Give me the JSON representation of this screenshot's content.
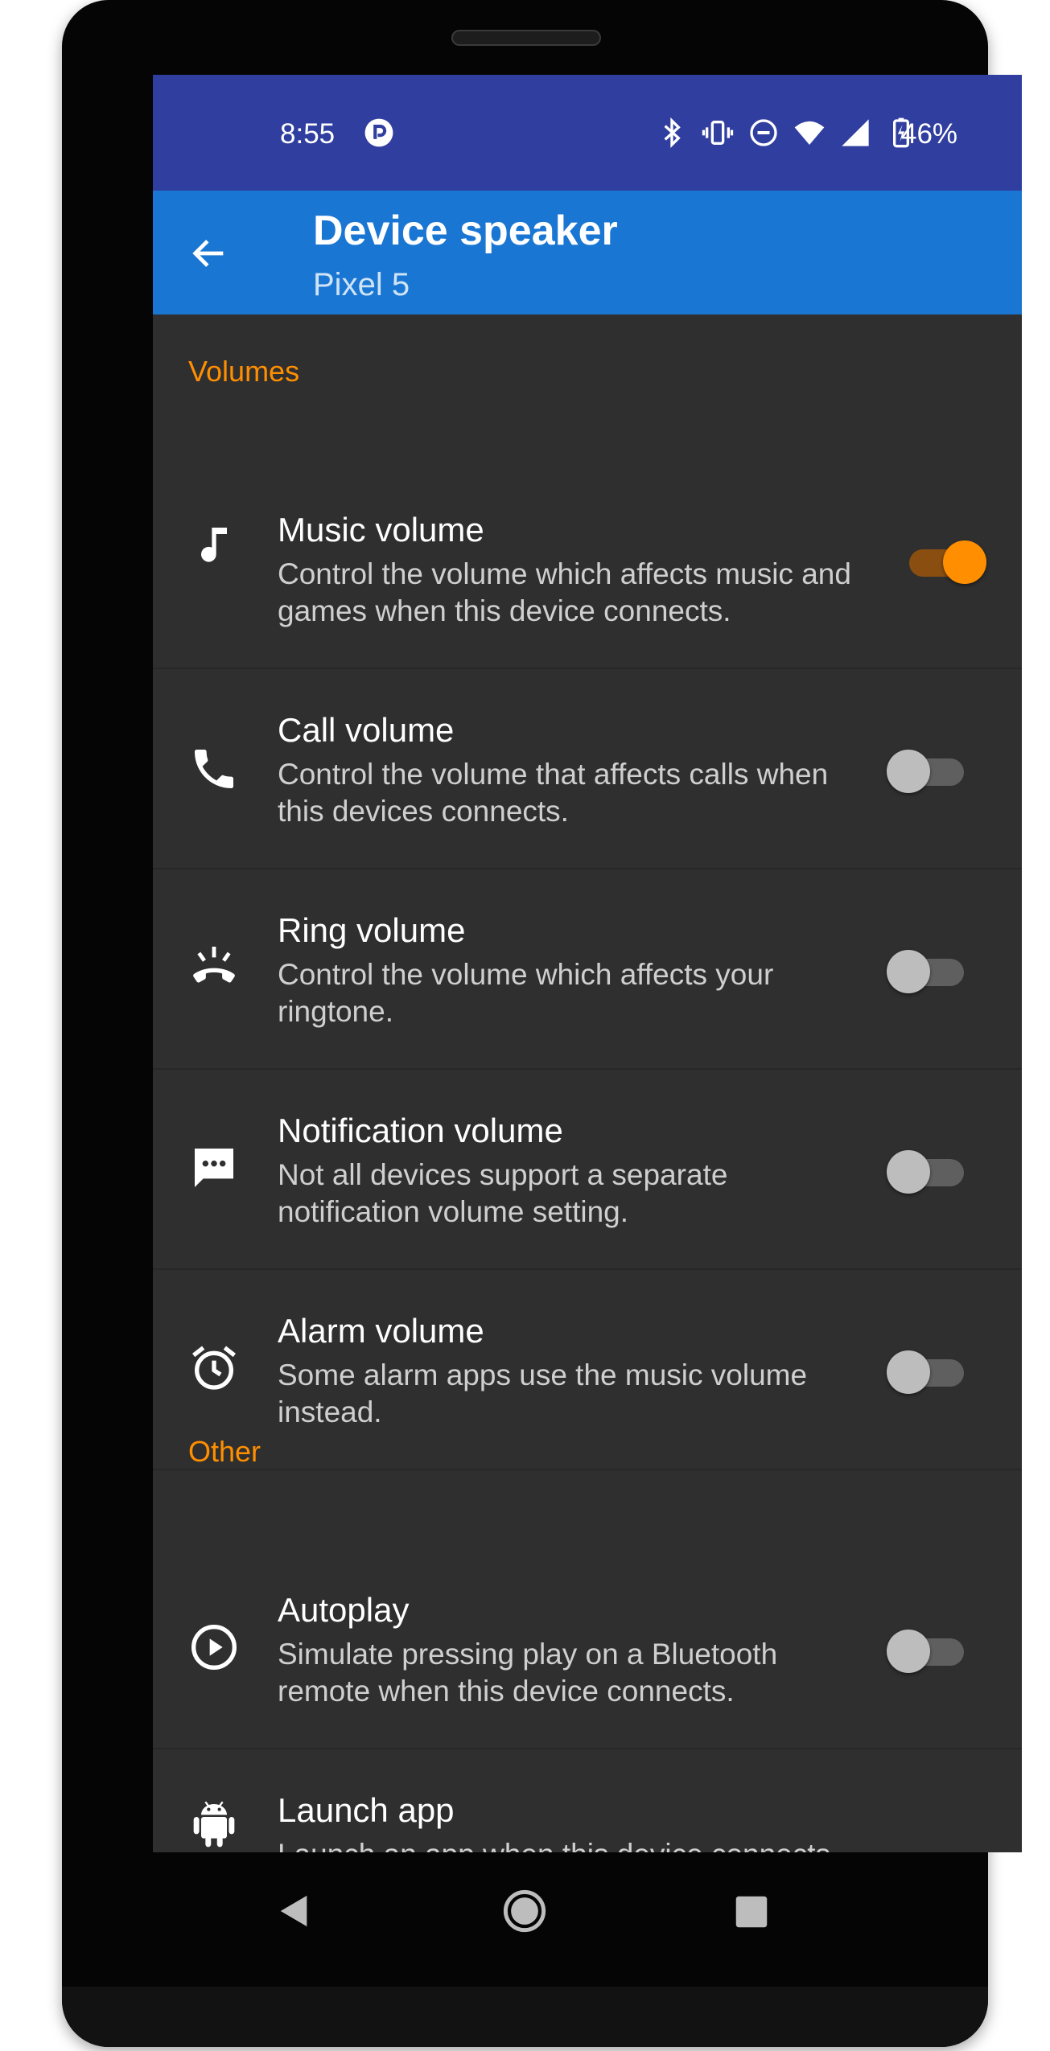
{
  "status_bar": {
    "time": "8:55",
    "battery_percent": "46%",
    "icons": [
      "pocket-casts-icon",
      "bluetooth-icon",
      "vibrate-icon",
      "dnd-icon",
      "wifi-icon",
      "cell-signal-icon",
      "battery-charging-icon"
    ]
  },
  "app_bar": {
    "title": "Device speaker",
    "subtitle": "Pixel 5",
    "back_icon": "arrow-back-icon"
  },
  "sections": {
    "volumes": {
      "header": "Volumes",
      "items": [
        {
          "title": "Music volume",
          "description": "Control the volume which affects music and games when this device connects.",
          "icon": "music-note-icon",
          "enabled": true
        },
        {
          "title": "Call volume",
          "description": "Control the volume that affects calls when this devices connects.",
          "icon": "phone-icon",
          "enabled": false
        },
        {
          "title": "Ring volume",
          "description": "Control the volume which affects your ringtone.",
          "icon": "ringing-phone-icon",
          "enabled": false
        },
        {
          "title": "Notification volume",
          "description": "Not all devices support a separate notification volume setting.",
          "icon": "message-icon",
          "enabled": false
        },
        {
          "title": "Alarm volume",
          "description": "Some alarm apps use the music volume instead.",
          "icon": "alarm-clock-icon",
          "enabled": false
        }
      ]
    },
    "other": {
      "header": "Other",
      "items": [
        {
          "title": "Autoplay",
          "description": "Simulate pressing play on a Bluetooth remote when this device connects.",
          "icon": "play-circle-icon",
          "enabled": false
        },
        {
          "title": "Launch app",
          "description": "Launch an app when this device connects.",
          "icon": "android-icon"
        }
      ]
    }
  },
  "nav_bar": {
    "buttons": [
      "back-triangle-icon",
      "home-circle-icon",
      "recents-square-icon"
    ]
  },
  "colors": {
    "status_bar": "#303f9f",
    "app_bar": "#1976d2",
    "accent": "#ff8f00",
    "background": "#2f2f2f"
  }
}
